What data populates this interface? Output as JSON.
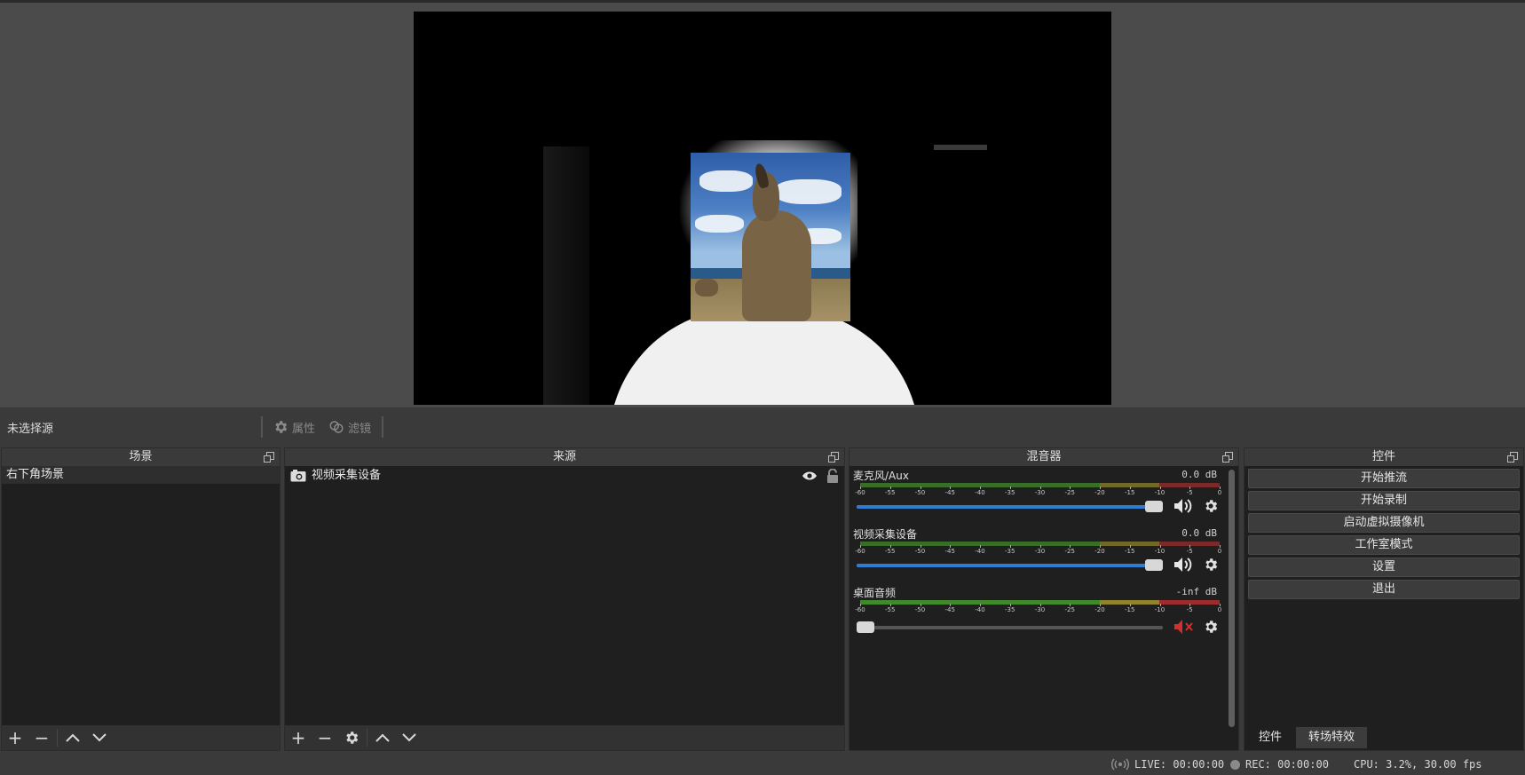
{
  "toolbar": {
    "no_source_label": "未选择源",
    "properties_label": "属性",
    "filters_label": "滤镜"
  },
  "docks": {
    "scenes": {
      "title": "场景",
      "items": [
        "右下角场景"
      ]
    },
    "sources": {
      "title": "来源",
      "items": [
        {
          "name": "视频采集设备",
          "icon": "camera-icon",
          "visible": true,
          "locked": false
        }
      ]
    },
    "mixer": {
      "title": "混音器",
      "ticks": [
        "-60",
        "-55",
        "-50",
        "-45",
        "-40",
        "-35",
        "-30",
        "-25",
        "-20",
        "-15",
        "-10",
        "-5",
        "0"
      ],
      "channels": [
        {
          "name": "麦克风/Aux",
          "db": "0.0 dB",
          "volume": 1.0,
          "muted": false
        },
        {
          "name": "视频采集设备",
          "db": "0.0 dB",
          "volume": 1.0,
          "muted": false
        },
        {
          "name": "桌面音频",
          "db": "-inf dB",
          "volume": 0.0,
          "muted": true
        }
      ]
    },
    "controls": {
      "title": "控件",
      "buttons": [
        "开始推流",
        "开始录制",
        "启动虚拟摄像机",
        "工作室模式",
        "设置",
        "退出"
      ],
      "tabs": [
        "控件",
        "转场特效"
      ]
    }
  },
  "status": {
    "live": "LIVE: 00:00:00",
    "rec": "REC: 00:00:00",
    "cpu": "CPU: 3.2%, 30.00 fps"
  },
  "colors": {
    "accent": "#2d7fd6",
    "meter_green": "#4caf30",
    "meter_yellow": "#b5a532",
    "meter_red": "#c83232",
    "mute_red": "#d03030"
  }
}
